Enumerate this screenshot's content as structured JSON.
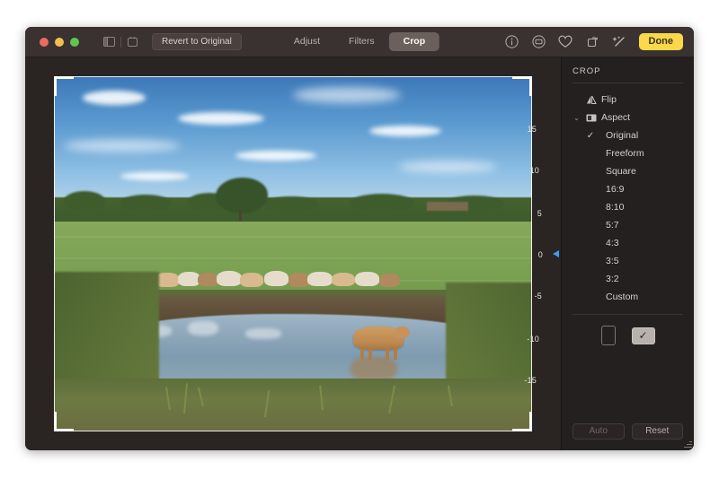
{
  "window": {
    "traffic_lights": [
      "close",
      "minimize",
      "zoom"
    ],
    "revert_label": "Revert to Original",
    "mini_icons": [
      "sidebar-toggle-icon",
      "info-panel-icon"
    ]
  },
  "toolbar": {
    "segments": [
      {
        "label": "Adjust",
        "active": false
      },
      {
        "label": "Filters",
        "active": false
      },
      {
        "label": "Crop",
        "active": true
      }
    ],
    "right_icons": [
      "info-icon",
      "comment-icon",
      "favorite-heart-icon",
      "rotate-icon",
      "auto-enhance-wand-icon"
    ],
    "done_label": "Done"
  },
  "sidebar": {
    "title": "CROP",
    "flip": {
      "label": "Flip",
      "icon": "flip-icon"
    },
    "aspect": {
      "label": "Aspect",
      "icon": "aspect-icon",
      "expanded": true
    },
    "aspect_options": [
      {
        "label": "Original",
        "selected": true
      },
      {
        "label": "Freeform",
        "selected": false
      },
      {
        "label": "Square",
        "selected": false
      },
      {
        "label": "16:9",
        "selected": false
      },
      {
        "label": "8:10",
        "selected": false
      },
      {
        "label": "5:7",
        "selected": false
      },
      {
        "label": "4:3",
        "selected": false
      },
      {
        "label": "3:5",
        "selected": false
      },
      {
        "label": "3:2",
        "selected": false
      },
      {
        "label": "Custom",
        "selected": false
      }
    ],
    "orientation": {
      "portrait": {
        "name": "portrait-orientation",
        "selected": false
      },
      "landscape": {
        "name": "landscape-orientation",
        "selected": true,
        "glyph": "✓"
      }
    },
    "footer": {
      "auto_label": "Auto",
      "auto_disabled": true,
      "reset_label": "Reset"
    }
  },
  "rotation_dial": {
    "labels": [
      "15",
      "10",
      "5",
      "0",
      "-5",
      "-10",
      "-15"
    ],
    "current_value": "0",
    "marker_color": "#3c9cf0"
  },
  "photo": {
    "alt": "Herd of cream-coloured cattle standing in a green meadow beside a muddy pond, with one tan cow standing in the water and its reflection visible; blue sky with scattered white clouds and a line of trees on the horizon.",
    "crop_handles": [
      "top-left",
      "top-right",
      "bottom-left",
      "bottom-right"
    ]
  },
  "colors": {
    "accent": "#f9d94b",
    "window_bg": "#2a2523",
    "titlebar_bg": "#3a3230",
    "sidebar_bg": "#242020",
    "marker": "#3c9cf0"
  }
}
